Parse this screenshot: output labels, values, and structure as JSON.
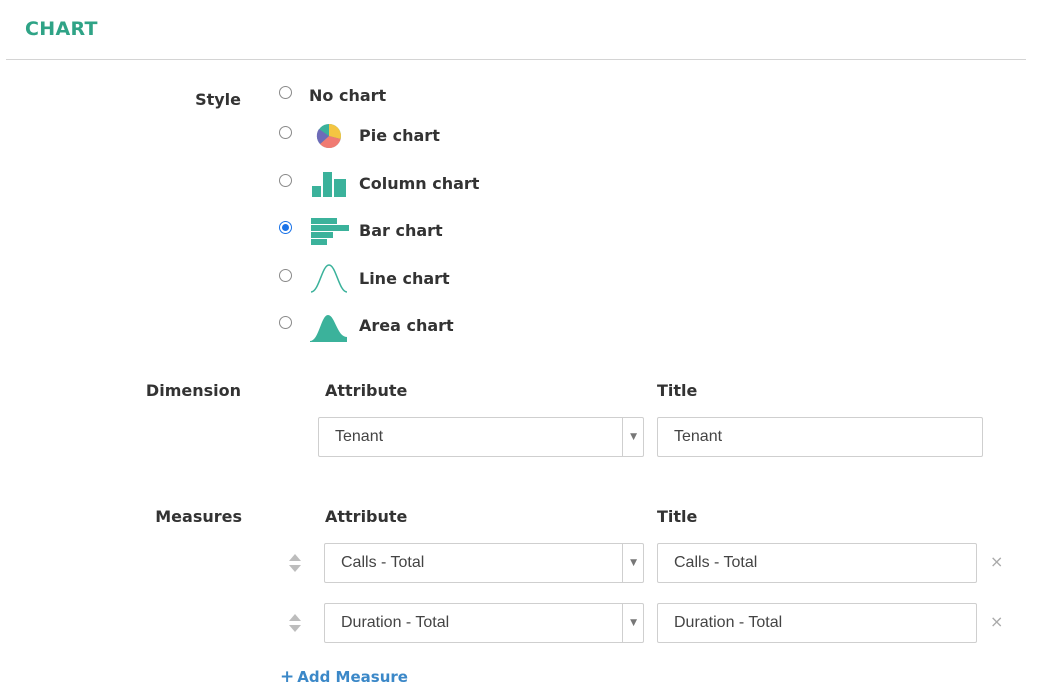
{
  "section": {
    "title": "CHART"
  },
  "style": {
    "label": "Style",
    "options": [
      {
        "label": "No chart",
        "icon": "none",
        "selected": false
      },
      {
        "label": "Pie chart",
        "icon": "pie-chart-icon",
        "selected": false
      },
      {
        "label": "Column chart",
        "icon": "column-chart-icon",
        "selected": false
      },
      {
        "label": "Bar chart",
        "icon": "bar-chart-icon",
        "selected": true
      },
      {
        "label": "Line chart",
        "icon": "line-chart-icon",
        "selected": false
      },
      {
        "label": "Area chart",
        "icon": "area-chart-icon",
        "selected": false
      }
    ]
  },
  "dimension": {
    "label": "Dimension",
    "attribute_header": "Attribute",
    "title_header": "Title",
    "attribute": "Tenant",
    "title": "Tenant"
  },
  "measures": {
    "label": "Measures",
    "attribute_header": "Attribute",
    "title_header": "Title",
    "rows": [
      {
        "attribute": "Calls - Total",
        "title": "Calls - Total"
      },
      {
        "attribute": "Duration - Total",
        "title": "Duration - Total"
      }
    ],
    "remove_symbol": "×",
    "add_label": "Add Measure",
    "add_symbol": "+"
  },
  "colors": {
    "accent": "#2fa386",
    "icon_teal": "#3bb29b",
    "radio_selected": "#1a73e8",
    "link": "#3b88c8"
  }
}
